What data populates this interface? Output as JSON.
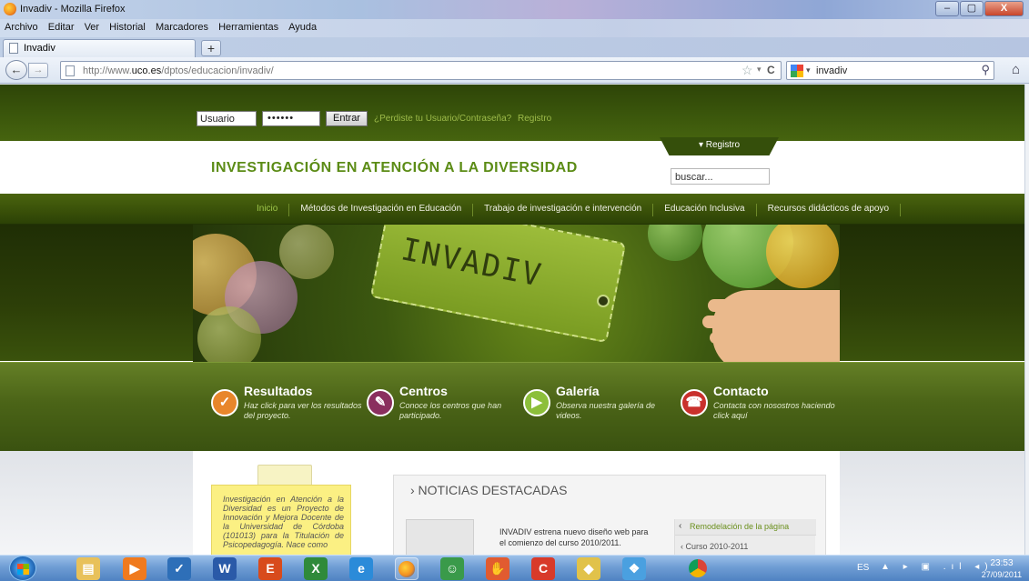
{
  "browser": {
    "window_title": "Invadiv - Mozilla Firefox",
    "menu": [
      "Archivo",
      "Editar",
      "Ver",
      "Historial",
      "Marcadores",
      "Herramientas",
      "Ayuda"
    ],
    "tab_title": "Invadiv",
    "new_tab": "+",
    "url_prefix": "http://www.",
    "url_domain": "uco.es",
    "url_path": "/dptos/educacion/invadiv/",
    "search_query": "invadiv",
    "window_buttons": {
      "minimize": "–",
      "maximize": "▢",
      "close": "X"
    }
  },
  "site": {
    "login": {
      "username": "Usuario",
      "password": "••••••",
      "submit": "Entrar",
      "forgot": "¿Perdiste tu Usuario/Contraseña?",
      "register": "Registro"
    },
    "registro_tab": "▾ Registro",
    "title": "INVESTIGACIÓN EN ATENCIÓN A LA DIVERSIDAD",
    "search_value": "buscar...",
    "nav": [
      "Inicio",
      "Métodos de Investigación en Educación",
      "Trabajo de investigación e intervención",
      "Educación Inclusiva",
      "Recursos didácticos de apoyo"
    ],
    "banner_text": "INVADIV",
    "features": [
      {
        "title": "Resultados",
        "desc": "Haz click para ver los resultados del proyecto.",
        "color": "#e8862b",
        "symbol": "✓"
      },
      {
        "title": "Centros",
        "desc": "Conoce los centros que han participado.",
        "color": "#8a2f5e",
        "symbol": "✎"
      },
      {
        "title": "Galería",
        "desc": "Observa nuestra galería de videos.",
        "color": "#8cbf3a",
        "symbol": "▶"
      },
      {
        "title": "Contacto",
        "desc": "Contacta con nosostros haciendo click aquí",
        "color": "#c9302c",
        "symbol": "☎"
      }
    ],
    "note": "Investigación en Atención a la Diversidad es un Proyecto de Innovación y Mejora Docente de la Universidad de Córdoba (101013) para la Titulación de Psicopedagogía. Nace como",
    "news": {
      "heading": "› NOTICIAS DESTACADAS",
      "item_text": "INVADIV estrena nuevo diseño web para el comienzo del curso 2010/2011.",
      "side_active": "Remodelación de la página",
      "side_other": "‹ Curso 2010-2011",
      "side_arrow": "‹"
    }
  },
  "taskbar": {
    "lang": "ES",
    "tray_icons": "▲ ▸ ▣ .ıl ◂)",
    "time": "23:53",
    "date": "27/09/2011"
  }
}
